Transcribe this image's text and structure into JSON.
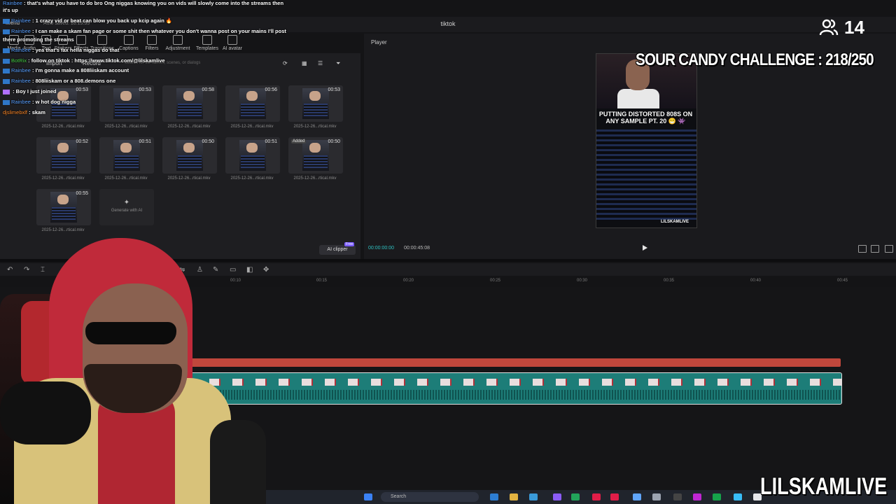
{
  "window": {
    "title": "tiktok"
  },
  "app": {
    "menu_label": "Menu",
    "autosave": "Auto saved: 10:15:35",
    "toolbar": [
      "Media",
      "Audio",
      "Text",
      "Stickers",
      "Effects",
      "Transitions",
      "Captions",
      "Filters",
      "Adjustment",
      "Templates",
      "AI avatar"
    ],
    "media_panel": {
      "import_label": "Import",
      "record_label": "Record",
      "search_placeholder": "Search for file names, scenes, or dialogs",
      "clips": [
        {
          "duration": "00:53",
          "name": "2025-12-26...rtical.mkv",
          "added": ""
        },
        {
          "duration": "00:53",
          "name": "2025-12-26...rtical.mkv",
          "added": ""
        },
        {
          "duration": "00:58",
          "name": "2025-12-26...rtical.mkv",
          "added": ""
        },
        {
          "duration": "00:56",
          "name": "2025-12-26...rtical.mkv",
          "added": ""
        },
        {
          "duration": "00:53",
          "name": "2025-12-26...rtical.mkv",
          "added": ""
        },
        {
          "duration": "00:52",
          "name": "2025-12-26...rtical.mkv",
          "added": ""
        },
        {
          "duration": "00:51",
          "name": "2025-12-26...rtical.mkv",
          "added": ""
        },
        {
          "duration": "00:50",
          "name": "2025-12-26...rtical.mkv",
          "added": ""
        },
        {
          "duration": "00:51",
          "name": "2025-12-26...rtical.mkv",
          "added": ""
        },
        {
          "duration": "00:50",
          "name": "2025-12-26...rtical.mkv",
          "added": "Added"
        },
        {
          "duration": "00:55",
          "name": "2025-12-26...rtical.mkv",
          "added": ""
        }
      ],
      "generate_ai_label": "Generate with AI",
      "ai_clipper_label": "AI clipper",
      "free_badge": "Free"
    },
    "player": {
      "label": "Player",
      "current_time": "00:00:00:00",
      "total_time": "00:00:45:08",
      "preview_caption": "PUTTING DISTORTED 808S ON ANY SAMPLE PT. 20 😁 👾",
      "preview_watermark": "LILSKAMLIVE"
    },
    "timeline": {
      "ticks": [
        "00:10",
        "00:15",
        "00:20",
        "00:25",
        "00:30",
        "00:35",
        "00:40",
        "00:45"
      ]
    }
  },
  "taskbar": {
    "search_label": "Search"
  },
  "chat": [
    {
      "user": "Rainbee",
      "text": "that's what you have to do bro Ong niggas knowing you on vids will slowly come into the streams then",
      "color": "#5aa0ff"
    },
    {
      "user": "",
      "text": "it's up",
      "color": "#ffffff"
    },
    {
      "user": "Rainbee",
      "text": "1 crazy vid or beat can blow you back up kcip again 🔥",
      "color": "#5aa0ff"
    },
    {
      "user": "Rainbee",
      "text": "I can make a skam fan page or some shit then whatever you don't wanna post on your mains I'll post",
      "color": "#5aa0ff"
    },
    {
      "user": "",
      "text": "there promoting the streams",
      "color": "#ffffff"
    },
    {
      "user": "Rainbee",
      "text": "yea that's fax hella niggas do that",
      "color": "#5aa0ff"
    },
    {
      "user": "BotRix",
      "text": "follow on tiktok : https://www.tiktok.com/@lilskamlive",
      "color": "#47d147"
    },
    {
      "user": "Rainbee",
      "text": "I'm gonna make a 808liiskam account",
      "color": "#5aa0ff"
    },
    {
      "user": "Rainbee",
      "text": "808liiskam or a 808.demons one",
      "color": "#5aa0ff"
    },
    {
      "user": "",
      "text": "Boy I just joined",
      "color": "#b070ff"
    },
    {
      "user": "Rainbee",
      "text": "w hot dog nigga",
      "color": "#5aa0ff"
    },
    {
      "user": "djslimebxlf",
      "text": "skam",
      "color": "#ff8a2a"
    }
  ],
  "overlay": {
    "viewer_count": "14",
    "challenge_text": "SOUR CANDY CHALLENGE : 218/250",
    "brand": "LILSKAMLIVE"
  },
  "colors": {
    "accent": "#2fc1c1",
    "audio_track": "#c0473c",
    "video_track": "#1d7d78"
  }
}
